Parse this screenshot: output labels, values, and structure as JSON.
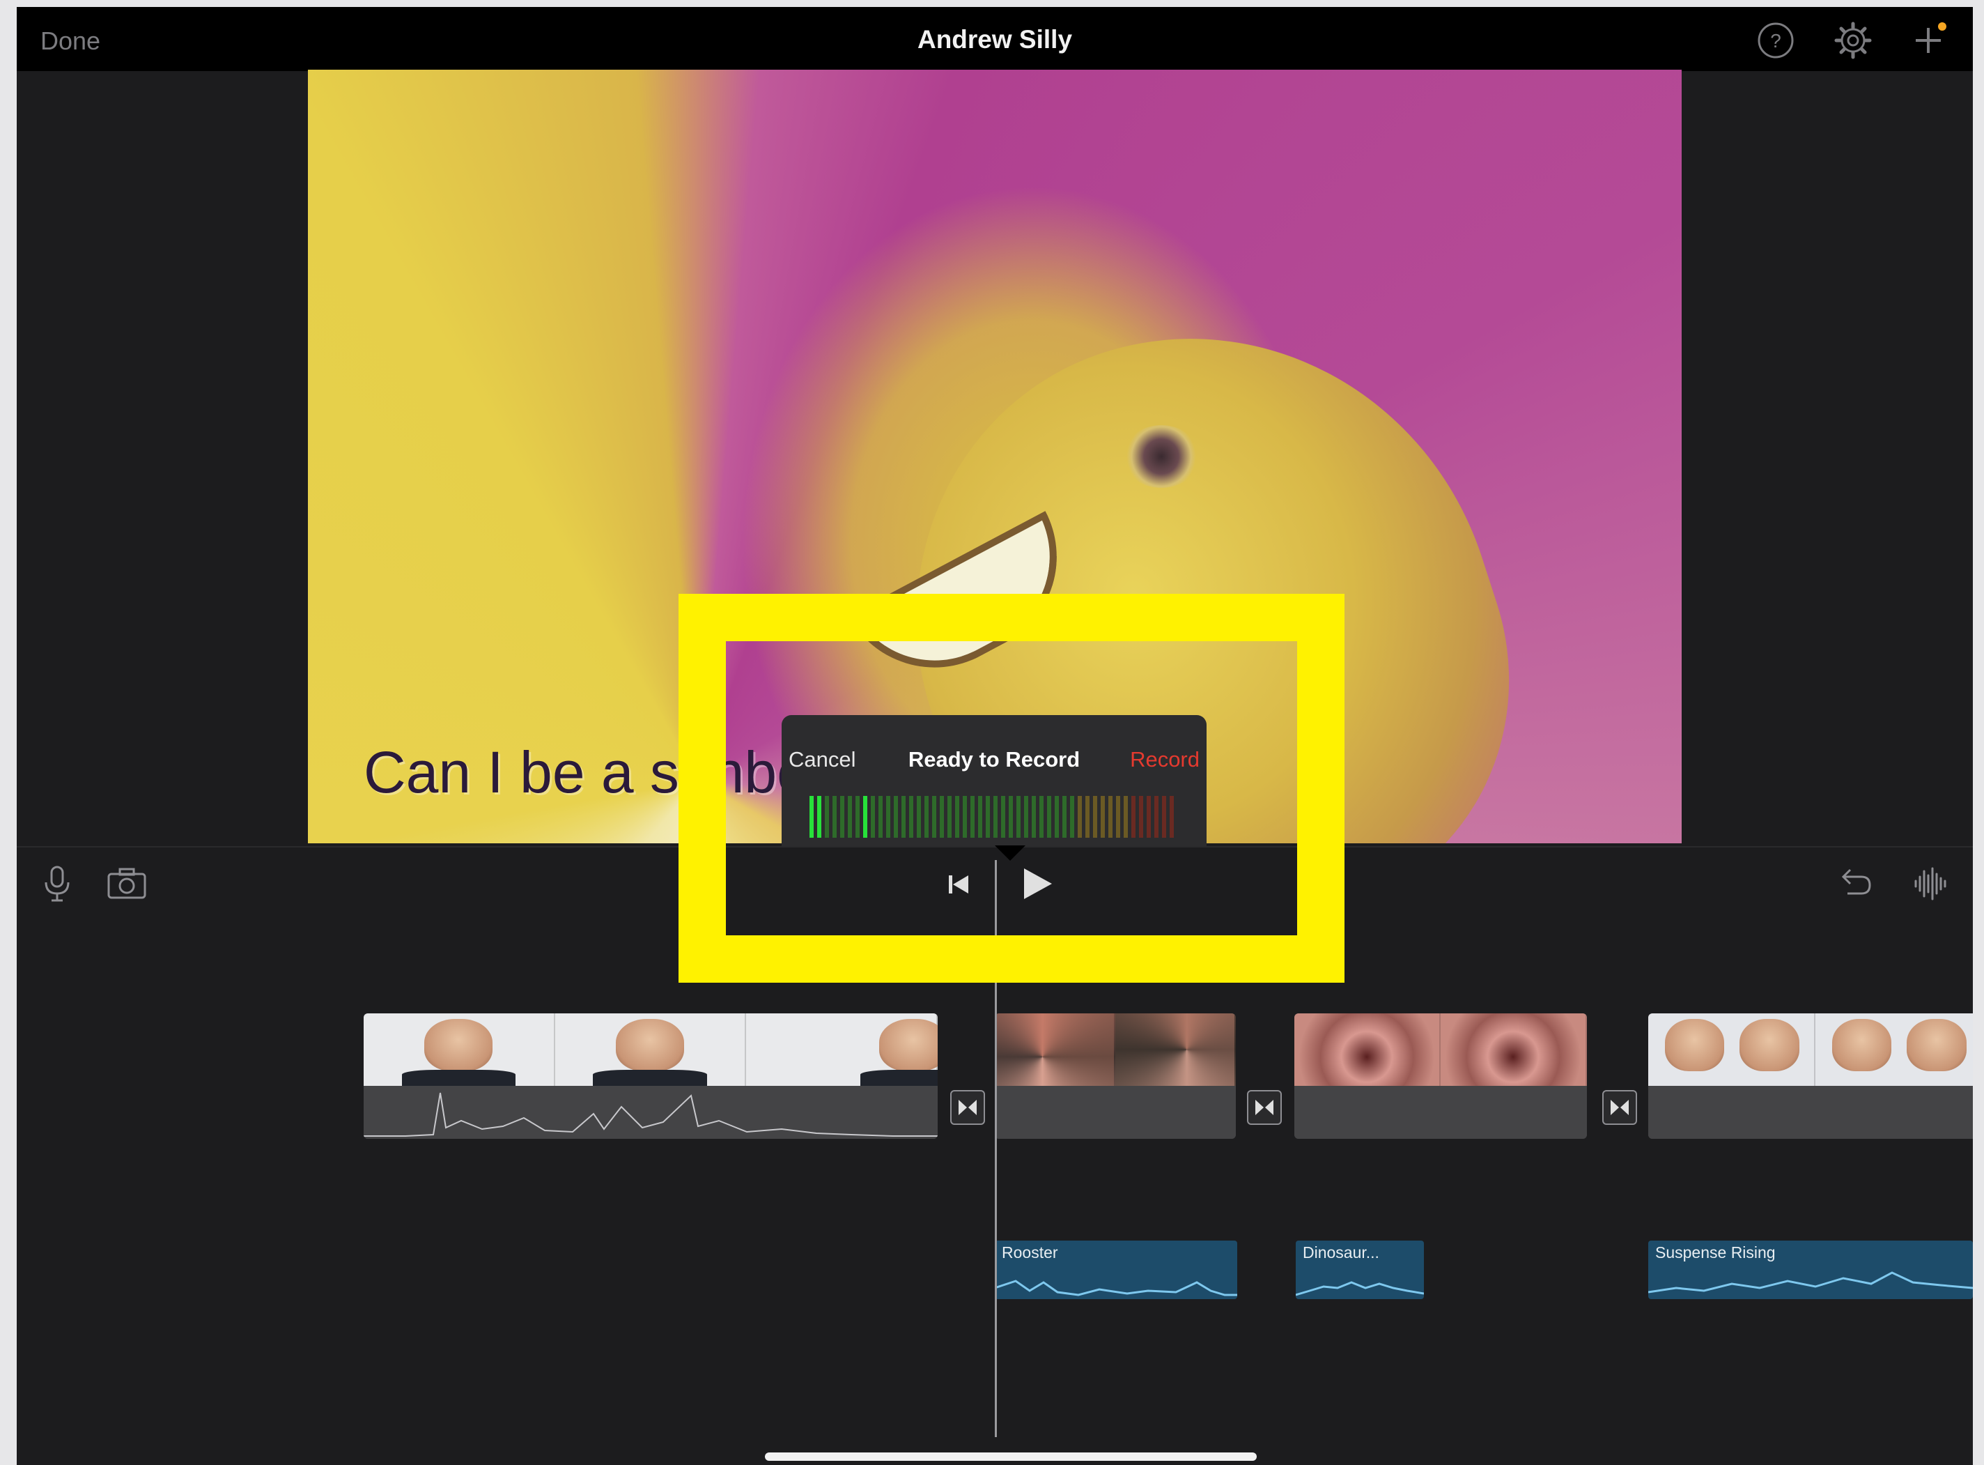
{
  "topbar": {
    "done_label": "Done",
    "title": "Andrew Silly",
    "icons": [
      "help-icon",
      "settings-icon",
      "add-icon"
    ],
    "add_badge_color": "#f5a623"
  },
  "viewer": {
    "subtitle": "Can I be a sunbeam?"
  },
  "record_popover": {
    "cancel_label": "Cancel",
    "status": "Ready to Record",
    "record_label": "Record",
    "record_color": "#e53a2f",
    "input_level": 0.04,
    "peak_level": 0.14
  },
  "toolbar": {
    "left_icons": [
      "mic-icon",
      "camera-icon"
    ],
    "center_icons": [
      "skip-back-icon",
      "play-icon"
    ],
    "right_icons": [
      "undo-icon",
      "waveform-icon"
    ]
  },
  "timeline": {
    "music_clips": [
      {
        "label": "Rooster"
      },
      {
        "label": "Dinosaur..."
      },
      {
        "label": "Suspense Rising"
      }
    ]
  },
  "annotation": {
    "highlight_color": "#fff200"
  }
}
